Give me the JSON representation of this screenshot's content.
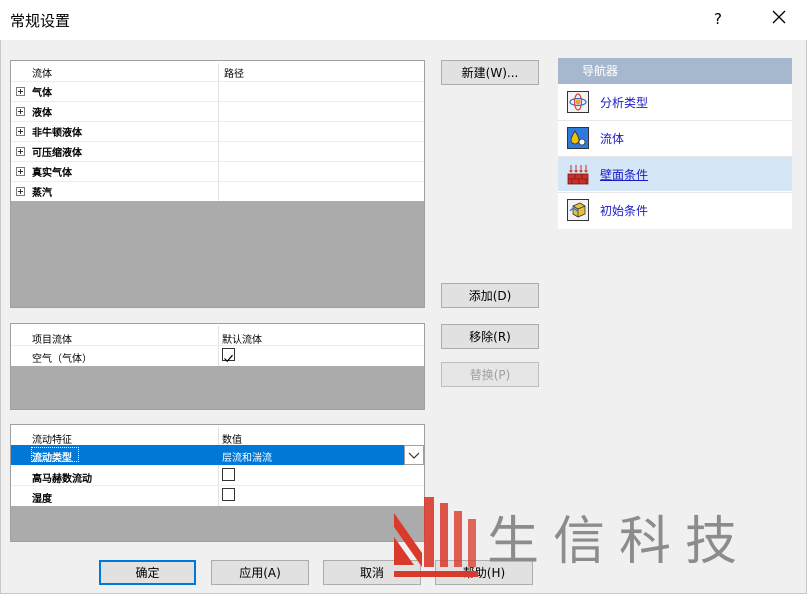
{
  "window": {
    "title": "常规设置",
    "help_glyph": "?"
  },
  "fluids_grid": {
    "columns": [
      "流体",
      "路径"
    ],
    "rows": [
      "气体",
      "液体",
      "非牛顿液体",
      "可压缩液体",
      "真实气体",
      "蒸汽"
    ]
  },
  "project_fluids_grid": {
    "columns": [
      "项目流体",
      "默认流体"
    ],
    "rows": [
      {
        "name": "空气（气体）",
        "default_checked": true
      }
    ]
  },
  "flow_grid": {
    "columns": [
      "流动特征",
      "数值"
    ],
    "rows": [
      {
        "name": "流动类型",
        "value": "层流和湍流",
        "selected": true
      },
      {
        "name": "高马赫数流动",
        "value": "",
        "checked": false
      },
      {
        "name": "湿度",
        "value": "",
        "checked": false
      }
    ]
  },
  "side_buttons": {
    "new": "新建(W)...",
    "add": "添加(D)",
    "remove": "移除(R)",
    "replace": "替换(P)"
  },
  "navigator": {
    "title": "导航器",
    "items": [
      {
        "label": "分析类型",
        "icon": "analysis-type-icon",
        "selected": false
      },
      {
        "label": "流体",
        "icon": "fluid-icon",
        "selected": false
      },
      {
        "label": "壁面条件",
        "icon": "wall-conditions-icon",
        "selected": true
      },
      {
        "label": "初始条件",
        "icon": "initial-conditions-icon",
        "selected": false
      }
    ]
  },
  "bottom_buttons": {
    "ok": "确定",
    "apply": "应用(A)",
    "cancel": "取消",
    "help": "帮助(H)"
  },
  "colors": {
    "selection": "#0078d7",
    "navigator_header": "#a6b8cd",
    "watermark_red": "#d93a2b"
  },
  "watermark": {
    "text": "生信科技"
  }
}
